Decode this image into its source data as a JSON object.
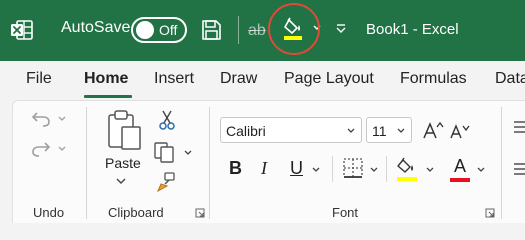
{
  "titlebar": {
    "app_icon": "excel-logo-icon",
    "autosave_label": "AutoSave",
    "autosave_state": "Off",
    "strikethrough_label": "ab",
    "document_title": "Book1  -  Excel",
    "accent": "#217346",
    "annotation_color": "#e04a36"
  },
  "tabs": [
    "File",
    "Home",
    "Insert",
    "Draw",
    "Page Layout",
    "Formulas",
    "Data"
  ],
  "active_tab": "Home",
  "ribbon": {
    "undo_group": "Undo",
    "clipboard": {
      "paste_label": "Paste",
      "group_label": "Clipboard"
    },
    "font": {
      "font_name": "Calibri",
      "font_size": "11",
      "bold": "B",
      "italic": "I",
      "underline": "U",
      "font_color_letter": "A",
      "group_label": "Font",
      "highlight_color": "#ffff00",
      "font_color": "#e81123"
    }
  }
}
